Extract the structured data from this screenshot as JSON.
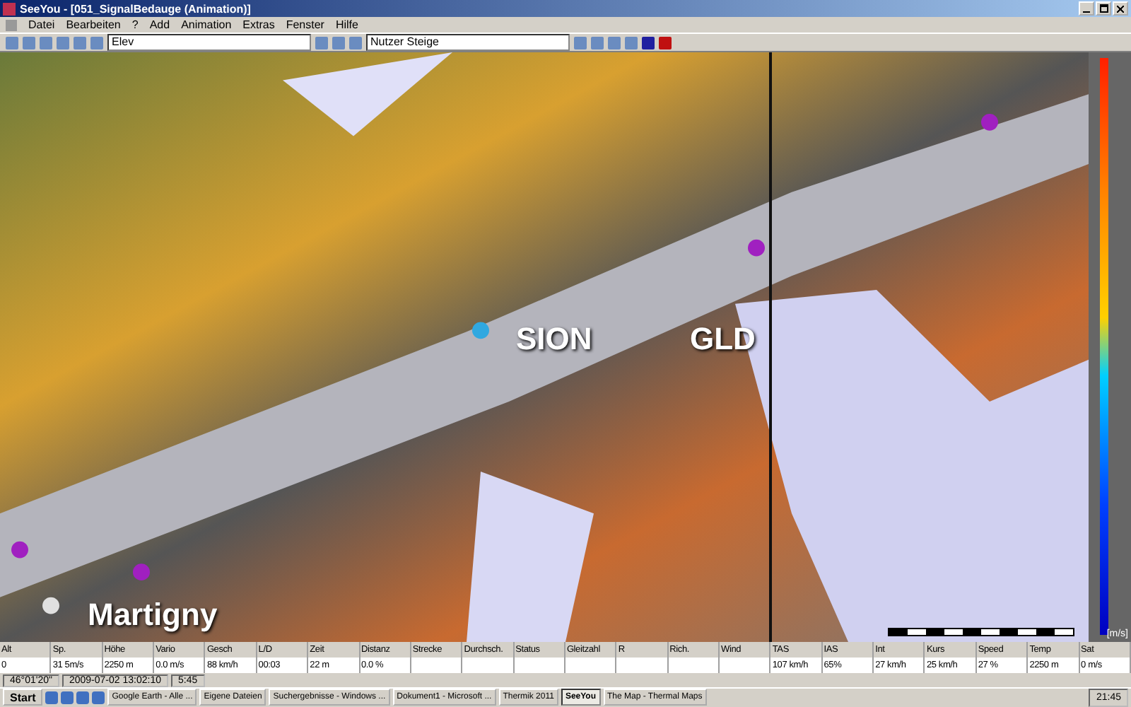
{
  "window": {
    "title": "SeeYou - [051_SignalBedauge (Animation)]"
  },
  "menu": [
    "Datei",
    "Bearbeiten",
    "?",
    "Add",
    "Animation",
    "Extras",
    "Fenster",
    "Hilfe"
  ],
  "toolbar": {
    "zoom_select": "Elev",
    "mode_select": "Nutzer Steige"
  },
  "map": {
    "labels": [
      "SION",
      "GLD",
      "Martigny"
    ],
    "scale_unit": "[m/s]"
  },
  "table": {
    "columns": [
      {
        "label": "Alt",
        "value": "0"
      },
      {
        "label": "Sp.",
        "value": "31 5m/s"
      },
      {
        "label": "Höhe",
        "value": "2250 m"
      },
      {
        "label": "Vario",
        "value": "0.0 m/s"
      },
      {
        "label": "Gesch",
        "value": "88 km/h"
      },
      {
        "label": "L/D",
        "value": "00:03"
      },
      {
        "label": "Zeit",
        "value": "22 m"
      },
      {
        "label": "Distanz",
        "value": "0.0 %"
      },
      {
        "label": "Strecke"
      },
      {
        "label": "Durchsch."
      },
      {
        "label": "Status"
      },
      {
        "label": "Gleitzahl"
      },
      {
        "label": "R"
      },
      {
        "label": "Rich."
      },
      {
        "label": "Wind"
      },
      {
        "label": "TAS",
        "value": "107 km/h"
      },
      {
        "label": "IAS",
        "value": "65%"
      },
      {
        "label": "Int",
        "value": "27 km/h"
      },
      {
        "label": "Kurs",
        "value": "25 km/h"
      },
      {
        "label": "Speed",
        "value": "27 %"
      },
      {
        "label": "Temp",
        "value": "2250 m"
      },
      {
        "label": "Sat",
        "value": "0 m/s"
      }
    ]
  },
  "status_bar": [
    "46°01'20\"",
    "2009-07-02 13:02:10",
    "5:45"
  ],
  "taskbar": {
    "start": "Start",
    "tasks": [
      {
        "label": "Google Earth - Alle ...",
        "selected": false
      },
      {
        "label": "Eigene Dateien",
        "selected": false
      },
      {
        "label": "Suchergebnisse - Windows ...",
        "selected": false
      },
      {
        "label": "Dokument1 - Microsoft ...",
        "selected": false
      },
      {
        "label": "Thermik 2011",
        "selected": false
      },
      {
        "label": "SeeYou",
        "selected": true
      },
      {
        "label": "The Map - Thermal Maps",
        "selected": false
      }
    ],
    "clock": "21:45"
  }
}
